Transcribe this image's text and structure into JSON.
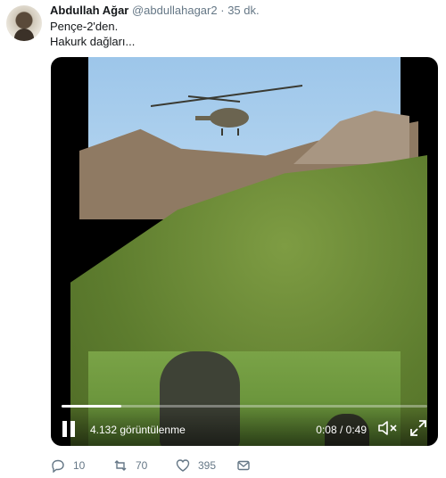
{
  "tweet": {
    "author_name": "Abdullah Ağar",
    "author_handle": "@abdullahagar2",
    "dot": "·",
    "time": "35 dk.",
    "text_line1": "Pençe-2'den.",
    "text_line2": "Hakurk dağları..."
  },
  "video": {
    "views": "4.132 görüntülenme",
    "timecode": "0:08 / 0:49",
    "progress_fraction": 0.163,
    "state": "playing",
    "icons": {
      "pause": "pause-icon",
      "mute": "mute-icon",
      "fullscreen": "fullscreen-icon"
    }
  },
  "actions": {
    "reply_count": "10",
    "retweet_count": "70",
    "like_count": "395",
    "icons": [
      "reply-icon",
      "retweet-icon",
      "like-icon",
      "message-icon"
    ]
  },
  "colors": {
    "text": "#14171a",
    "muted": "#657786",
    "icon": "#657786"
  }
}
